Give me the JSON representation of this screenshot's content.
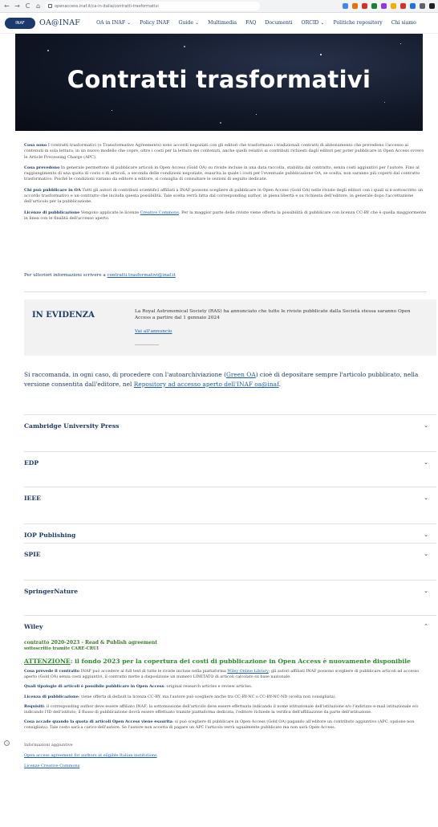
{
  "browser": {
    "back": "←",
    "forward": "→",
    "reload": "C",
    "home": "⌂",
    "url": "openaccess.inaf.it/ca-in-italia/contratti-trasformativi",
    "extension_colors": [
      "#4285f4",
      "#e8710a",
      "#d93025",
      "#188038",
      "#9334e6",
      "#f9ab00",
      "#d93025",
      "#1a73e8",
      "#5f6368",
      "#202124"
    ]
  },
  "site": {
    "logo_badge": "INAF",
    "logo_text": "OA@INAF",
    "menu": [
      "OA in INAF ⌄",
      "Policy INAF",
      "Guide ⌄",
      "Multimedia",
      "FAQ",
      "Documenti",
      "ORCID ⌄",
      "Politiche repository",
      "Chi siamo"
    ]
  },
  "hero": {
    "title": "Contratti trasformativi"
  },
  "intro": {
    "p1_label": "Cosa sono",
    "p1_text": " I contratti trasformativi (o Transformative Agreements) sono accordi negoziati con gli editori che trasformano i tradizionali contratti di abbonamento che prevedono l'accesso ai contenuti in sola lettura, in un nuovo modello che copre, oltre i costi per la lettura dei contenuti, anche quelli relativi ai contributi richiesti dagli editori per poter pubblicare in Open Access ovvero le Article Processing Charge (APC).",
    "p2_label": "Cosa prevedono",
    "p2_text": " In generale permettono di pubblicare articoli in Open Access (Gold OA) su riviste incluse in una data raccolta, stabilita dal contratto, senza costi aggiuntivi per l'autore. Fino al raggiungimento di una quota di costo o di articoli, a seconda delle condizioni negoziate, esaurita la quale i costi per l'eventuale pubblicazione OA, se scelta, non saranno più coperti dal contratto trasformativo. Poiché le condizioni variano da editore a editore, si consiglia di consultare le sezioni di seguito dedicate.",
    "p3_label": "Chi può pubblicare in OA",
    "p3_text": " Tutti gli autori di contributi scientifici affiliati a INAF possono scegliere di pubblicare in Open Access (Gold OA) nelle riviste degli editori con i quali si è sottoscritto un accordo trasformativo e un contratto che includa questa possibilità. Tale scelta verrà fatta dal corresponding author, in piena libertà e su richiesta dell'editore, in generale dopo l'accettazione dell'articolo per la pubblicazione.",
    "p4_label": "Licenze di pubblicazione",
    "p4_text_a": " Vengono applicate le licenze ",
    "p4_link": "Creative Commons",
    "p4_text_b": ". Per la maggior parte delle riviste viene offerta la possibilità di pubblicare con licenza CC-BY che è quella maggiormente in linea con le finalità dell'accesso aperto.",
    "contact_prefix": "Per ulteriori informazioni scrivere a ",
    "contact_link": "contratti.trasformativi@inaf.it"
  },
  "evidenza": {
    "title": "IN EVIDENZA",
    "text": "La Royal Astronomical Society (RAS) ha annunciato che tutte le riviste pubblicate dalla Società stessa saranno Open Access a partire dal 1 gennaio 2024",
    "link": "Vai all'annuncio"
  },
  "recommend": {
    "a": "Si raccomanda, in ogni caso, di procedere con l'autoarchiviazione (",
    "green": "Green OA",
    "b": ") cioè di depositare sempre l'articolo pubblicato, nella versione consentita dall'editore, nel ",
    "repo": "Repository ad accesso aperto dell'INAF oa@inaf",
    "c": "."
  },
  "publishers": [
    "Cambridge University Press",
    "EDP",
    "IEEE",
    "IOP Publishing",
    "SPIE",
    "SpringerNature",
    "Wiley"
  ],
  "chevron_down": "⌄",
  "chevron_up": "⌃",
  "wiley": {
    "contract": "contratto 2020-2023 - Read & Publish agreement",
    "via": "sottoscritto tramite CARE-CRUI",
    "attn_label": "ATTENZIONE",
    "attn_text": ": il fondo 2023 per la copertura dei costi di pubblicazione in Open Access è nuovamente disponibile",
    "p1_label": "Cosa prevede il contratto",
    "p1_a": " INAF può accedere al full text di tutte le riviste incluse nella piattaforma ",
    "p1_link": "Wiley Online Library",
    "p1_b": "; gli autori affiliati INAF possono scegliere di pubblicare articoli ad accesso aperto (Gold OA) senza costi aggiuntivi, il contratto mette a disposizione un numero LIMITATO di articoli calcolato su base nazionale.",
    "p2_label": "Quali tipologie di articoli è possibile pubblicare in Open Access",
    "p2_text": ": original research articles e review articles.",
    "p3_label": "Licenza di pubblicazione",
    "p3_text": ": viene offerta di default la licenza CC-BY, ma l'autore può scegliere anche tra CC-BY-NC o CC-BY-NC-ND (scelta non consigliata).",
    "p4_label": "Requisiti",
    "p4_text": ": il corresponding author deve essere affiliato INAF; la sottomissione dell'articolo deve essere effettuata indicando il nome istituzionale dell'istituzione e/o l'indirizzo e-mail istituzionale e/o indicando l'ID dell'istituto; il flusso di pubblicazione dovrà essere effettuato tramite piattaforma dedicata, l'editore richiede la verifica dell'affiliazione da parte dell'istituzione.",
    "p5_label": "Cosa accade quando la quota di articoli Open Access viene esaurita",
    "p5_text": ": si può scegliere di pubblicare in Open Access (Gold OA) pagando all'editore un contributo aggiuntivo (APC, opzione non consigliata). Tale costo sarà a carico dell'autore. Se l'autore non accetta di pagare un APC l'articolo verrà ugualmente pubblicato ma non sarà Open Access.",
    "info_label": "Informazioni aggiuntive",
    "link1": "Open access agreement for authors at eligible Italian institutions",
    "link2": "Licenze Creative Commons"
  },
  "side_icon": "⊃"
}
